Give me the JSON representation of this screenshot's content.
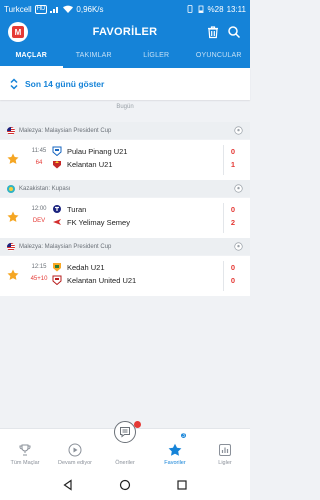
{
  "status_bar": {
    "carrier": "Turkcell",
    "network_badge": "HD",
    "speed": "0,96K/s",
    "battery": "%28",
    "time": "13:11"
  },
  "app": {
    "title": "FAVORİLER",
    "logo_letter": "M"
  },
  "tabs": [
    {
      "label": "MAÇLAR",
      "active": true
    },
    {
      "label": "TAKIMLAR",
      "active": false
    },
    {
      "label": "LİGLER",
      "active": false
    },
    {
      "label": "OYUNCULAR",
      "active": false
    }
  ],
  "filter": {
    "label": "Son 14 günü göster"
  },
  "day_label": "Bugün",
  "leagues": [
    {
      "name": "Malezya: Malaysian President Cup",
      "flag": "my",
      "match": {
        "time": "11:45",
        "status": "64",
        "home": "Pulau Pinang U21",
        "away": "Kelantan U21",
        "home_score": "0",
        "away_score": "1",
        "home_crest_color": "#1565c0",
        "away_crest_color": "#c62828"
      }
    },
    {
      "name": "Kazakistan: Kupası",
      "flag": "kz",
      "match": {
        "time": "12:00",
        "status": "DEV",
        "home": "Turan",
        "away": "FK Yelimay Semey",
        "home_score": "0",
        "away_score": "2",
        "home_crest_color": "#1a237e",
        "away_crest_color": "#d32f2f"
      }
    },
    {
      "name": "Malezya: Malaysian President Cup",
      "flag": "my",
      "match": {
        "time": "12:15",
        "status": "45+10",
        "home": "Kedah U21",
        "away": "Kelantan United U21",
        "home_score": "0",
        "away_score": "0",
        "home_crest_color": "#f9a825",
        "away_crest_color": "#b71c1c"
      }
    }
  ],
  "bottom_nav": [
    {
      "label": "Tüm Maçlar",
      "icon": "trophy-icon",
      "active": false
    },
    {
      "label": "Devam ediyor",
      "icon": "play-icon",
      "active": false
    },
    {
      "label": "Öneriler",
      "icon": "tips-icon",
      "active": false
    },
    {
      "label": "Favoriler",
      "icon": "star-icon",
      "active": true,
      "badge": "3"
    },
    {
      "label": "Ligler",
      "icon": "bar-chart-icon",
      "active": false
    }
  ],
  "colors": {
    "primary": "#1583d8",
    "live": "#e53935",
    "star": "#f5a623"
  }
}
